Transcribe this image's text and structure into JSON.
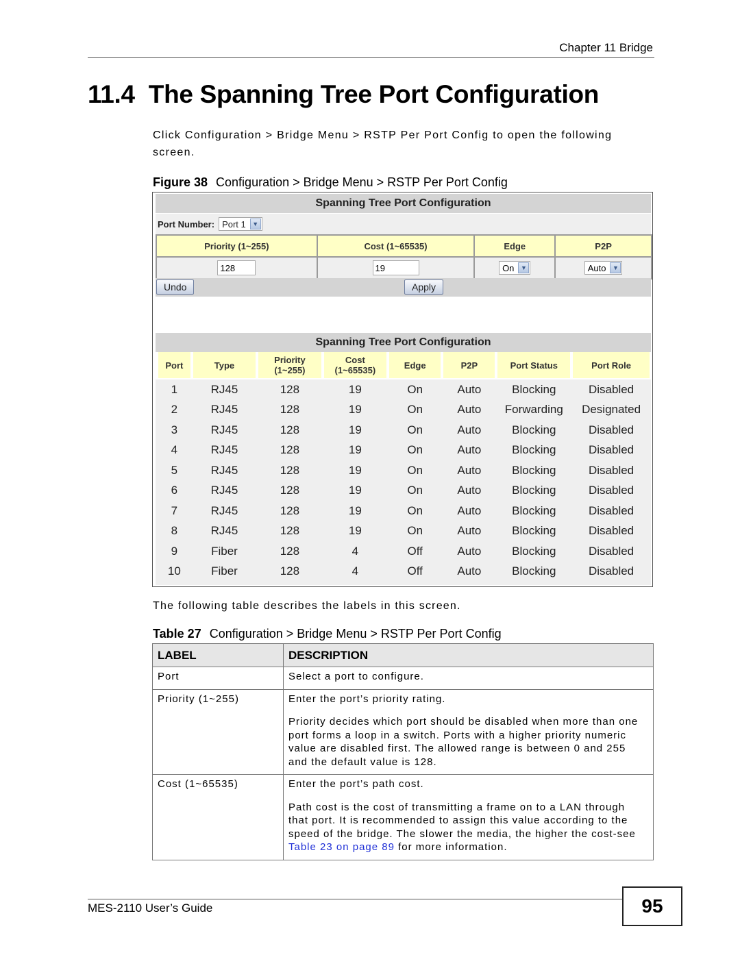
{
  "header": {
    "chapter": "Chapter 11 Bridge"
  },
  "section": {
    "number": "11.4",
    "title": "The Spanning Tree Port Configuration"
  },
  "intro": "Click Configuration > Bridge Menu > RSTP Per Port Config to open the following screen.",
  "figure": {
    "label": "Figure 38",
    "caption": "Configuration > Bridge Menu > RSTP Per Port Config",
    "screen": {
      "title": "Spanning Tree Port Configuration",
      "port_number_label": "Port Number:",
      "port_number_value": "Port 1",
      "config_headers": [
        "Priority (1~255)",
        "Cost (1~65535)",
        "Edge",
        "P2P"
      ],
      "priority_value": "128",
      "cost_value": "19",
      "edge_value": "On",
      "p2p_value": "Auto",
      "undo_label": "Undo",
      "apply_label": "Apply",
      "status_title": "Spanning Tree Port Configuration",
      "status_headers": [
        {
          "line1": "Port",
          "line2": ""
        },
        {
          "line1": "Type",
          "line2": ""
        },
        {
          "line1": "Priority",
          "line2": "(1~255)"
        },
        {
          "line1": "Cost",
          "line2": "(1~65535)"
        },
        {
          "line1": "Edge",
          "line2": ""
        },
        {
          "line1": "P2P",
          "line2": ""
        },
        {
          "line1": "Port Status",
          "line2": ""
        },
        {
          "line1": "Port Role",
          "line2": ""
        }
      ],
      "rows": [
        [
          "1",
          "RJ45",
          "128",
          "19",
          "On",
          "Auto",
          "Blocking",
          "Disabled"
        ],
        [
          "2",
          "RJ45",
          "128",
          "19",
          "On",
          "Auto",
          "Forwarding",
          "Designated"
        ],
        [
          "3",
          "RJ45",
          "128",
          "19",
          "On",
          "Auto",
          "Blocking",
          "Disabled"
        ],
        [
          "4",
          "RJ45",
          "128",
          "19",
          "On",
          "Auto",
          "Blocking",
          "Disabled"
        ],
        [
          "5",
          "RJ45",
          "128",
          "19",
          "On",
          "Auto",
          "Blocking",
          "Disabled"
        ],
        [
          "6",
          "RJ45",
          "128",
          "19",
          "On",
          "Auto",
          "Blocking",
          "Disabled"
        ],
        [
          "7",
          "RJ45",
          "128",
          "19",
          "On",
          "Auto",
          "Blocking",
          "Disabled"
        ],
        [
          "8",
          "RJ45",
          "128",
          "19",
          "On",
          "Auto",
          "Blocking",
          "Disabled"
        ],
        [
          "9",
          "Fiber",
          "128",
          "4",
          "Off",
          "Auto",
          "Blocking",
          "Disabled"
        ],
        [
          "10",
          "Fiber",
          "128",
          "4",
          "Off",
          "Auto",
          "Blocking",
          "Disabled"
        ]
      ]
    }
  },
  "following_text": "The following table describes the labels in this screen.",
  "table27": {
    "label": "Table 27",
    "caption": "Configuration > Bridge Menu > RSTP Per Port Config",
    "headers": {
      "label": "LABEL",
      "description": "DESCRIPTION"
    },
    "rows": [
      {
        "label": "Port",
        "paragraphs": [
          "Select a port to configure."
        ]
      },
      {
        "label": "Priority (1~255)",
        "paragraphs": [
          "Enter the port’s priority rating.",
          "Priority decides which port should be disabled when more than one port forms a loop in a switch. Ports with a higher priority numeric value are disabled first. The allowed range is between 0 and 255 and the default value is 128."
        ]
      },
      {
        "label": "Cost (1~65535)",
        "paragraphs": [
          "Enter the port’s path cost.",
          "Path cost is the cost of transmitting a frame on to a LAN through that port. It is recommended to assign this value according to the speed of the bridge. The slower the media, the higher the cost-see"
        ],
        "link": "Table 23 on page 89",
        "after_link": " for more information."
      }
    ]
  },
  "footer": {
    "guide": "MES-2110 User’s Guide",
    "page": "95"
  },
  "colors": {
    "header_yellow": "#ffffc6",
    "title_gray": "#d4d4d4",
    "body_gray": "#efefef",
    "link_blue": "#1f2fd6"
  }
}
